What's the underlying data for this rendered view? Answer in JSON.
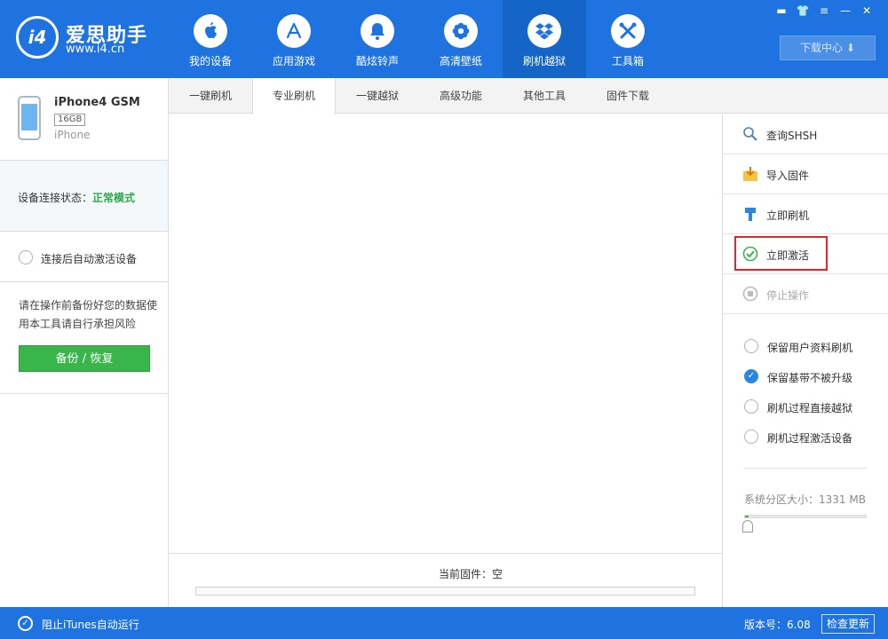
{
  "app": {
    "name": "爱思助手",
    "url": "www.i4.cn",
    "logo_text": "i4"
  },
  "nav": {
    "items": [
      {
        "label": "我的设备",
        "icon": "apple-icon"
      },
      {
        "label": "应用游戏",
        "icon": "app-store-icon"
      },
      {
        "label": "酷炫铃声",
        "icon": "bell-icon"
      },
      {
        "label": "高清壁纸",
        "icon": "flower-icon"
      },
      {
        "label": "刷机越狱",
        "icon": "dropbox-icon"
      },
      {
        "label": "工具箱",
        "icon": "tools-icon"
      }
    ],
    "active_index": 4
  },
  "window": {
    "controls": [
      "▬",
      "👕",
      "≡",
      "—",
      "✕"
    ],
    "download_center": "下载中心"
  },
  "device": {
    "name": "iPhone4 GSM",
    "capacity": "16GB",
    "type": "iPhone",
    "status_label": "设备连接状态：",
    "status_value": "正常模式",
    "auto_activate_label": "连接后自动激活设备",
    "backup_tip": "请在操作前备份好您的数据使用本工具请自行承担风险",
    "backup_button": "备份 / 恢复"
  },
  "tabs": {
    "items": [
      "一键刷机",
      "专业刷机",
      "一键越狱",
      "高级功能",
      "其他工具",
      "固件下载"
    ],
    "active_index": 1
  },
  "center": {
    "firmware_label": "当前固件：空",
    "progress": 0
  },
  "actions": [
    {
      "label": "查询SHSH",
      "icon": "search-icon",
      "enabled": true
    },
    {
      "label": "导入固件",
      "icon": "import-icon",
      "enabled": true
    },
    {
      "label": "立即刷机",
      "icon": "brush-icon",
      "enabled": true
    },
    {
      "label": "立即激活",
      "icon": "check-circle-icon",
      "enabled": true,
      "highlighted": true
    },
    {
      "label": "停止操作",
      "icon": "stop-icon",
      "enabled": false
    }
  ],
  "options": [
    {
      "label": "保留用户资料刷机",
      "checked": false
    },
    {
      "label": "保留基带不被升级",
      "checked": true
    },
    {
      "label": "刷机过程直接越狱",
      "checked": false
    },
    {
      "label": "刷机过程激活设备",
      "checked": false
    }
  ],
  "partition": {
    "label": "系统分区大小：1331 MB",
    "value_mb": 1331
  },
  "statusbar": {
    "itunes_label": "阻止iTunes自动运行",
    "version": "版本号：6.08",
    "check_update": "检查更新"
  },
  "colors": {
    "brand_blue": "#1e73e0",
    "active_nav": "#1565c8",
    "green": "#3ab54a",
    "highlight_red": "#e0262a",
    "checked_blue": "#2b86e0"
  }
}
